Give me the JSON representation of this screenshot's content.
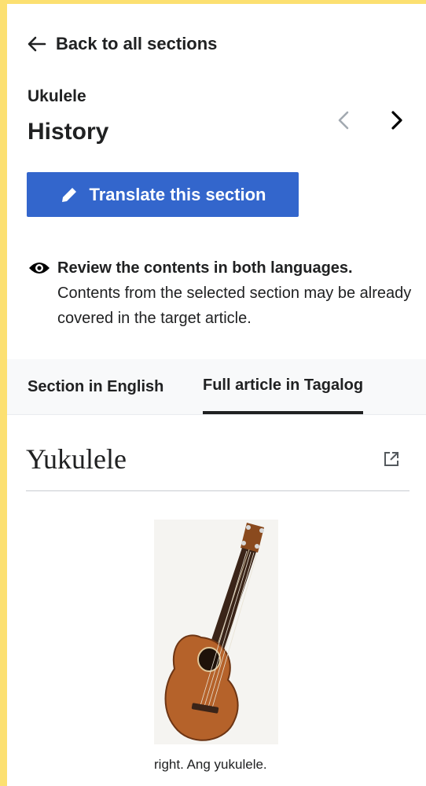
{
  "nav": {
    "back_label": "Back to all sections"
  },
  "article": {
    "name": "Ukulele",
    "section": "History"
  },
  "actions": {
    "translate_label": "Translate this section"
  },
  "review": {
    "heading": "Review the contents in both languages.",
    "body": "Contents from the selected section may be already covered in the target article."
  },
  "tabs": [
    {
      "label": "Section in English",
      "active": false
    },
    {
      "label": "Full article in Tagalog",
      "active": true
    }
  ],
  "target_article": {
    "title": "Yukulele",
    "caption": "right. Ang yukulele."
  },
  "colors": {
    "accent": "#3366cc",
    "frame": "#fce071"
  },
  "icons": [
    "arrow-left-icon",
    "chevron-left-icon",
    "chevron-right-icon",
    "pencil-icon",
    "eye-icon",
    "external-link-icon"
  ]
}
